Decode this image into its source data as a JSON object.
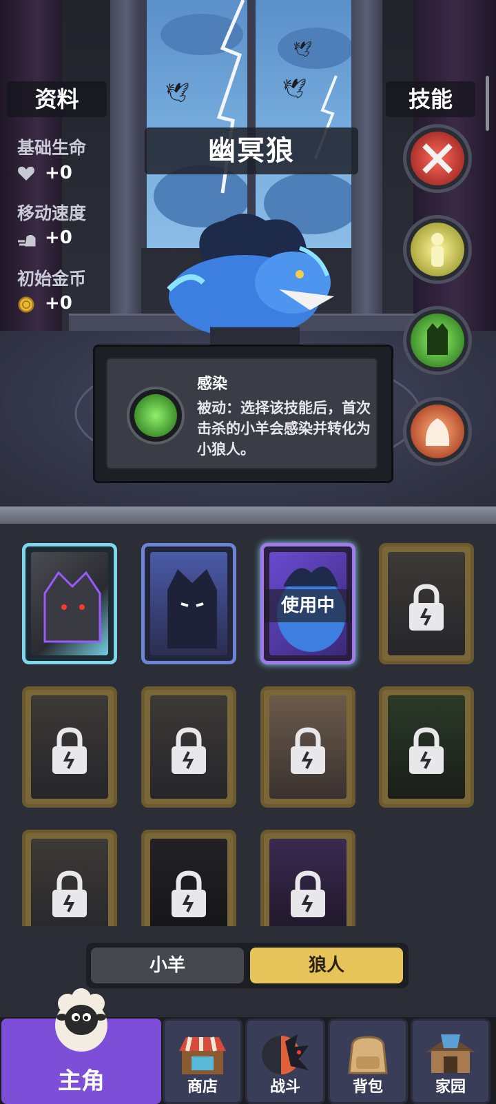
{
  "stats_header": "资料",
  "skills_header": "技能",
  "character_name": "幽冥狼",
  "stats": [
    {
      "label": "基础生命",
      "value": "+0",
      "icon": "heart-icon"
    },
    {
      "label": "移动速度",
      "value": "+0",
      "icon": "speed-icon"
    },
    {
      "label": "初始金币",
      "value": "+0",
      "icon": "gold-coin-icon"
    }
  ],
  "skills": [
    {
      "icon": "crossed-swords-icon",
      "color": "#e0403a"
    },
    {
      "icon": "yellow-figure-icon",
      "color": "#e4e04a"
    },
    {
      "icon": "green-wolf-icon",
      "color": "#4ad23a"
    },
    {
      "icon": "fire-beast-icon",
      "color": "#e85a2a"
    }
  ],
  "tooltip": {
    "title": "感染",
    "description": "被动：选择该技能后，首次击杀的小羊会感染并转化为小狼人。"
  },
  "cards": {
    "in_use_label": "使用中",
    "items": [
      {
        "status": "unlocked",
        "frame": "cyan"
      },
      {
        "status": "unlocked",
        "frame": "blue"
      },
      {
        "status": "in_use",
        "frame": "purple"
      },
      {
        "status": "locked"
      },
      {
        "status": "locked"
      },
      {
        "status": "locked"
      },
      {
        "status": "locked"
      },
      {
        "status": "locked"
      },
      {
        "status": "locked"
      },
      {
        "status": "locked"
      },
      {
        "status": "locked"
      }
    ]
  },
  "tabs": {
    "sheep": "小羊",
    "werewolf": "狼人",
    "active": "werewolf"
  },
  "nav": {
    "main": "主角",
    "shop": "商店",
    "battle": "战斗",
    "bag": "背包",
    "home": "家园"
  }
}
